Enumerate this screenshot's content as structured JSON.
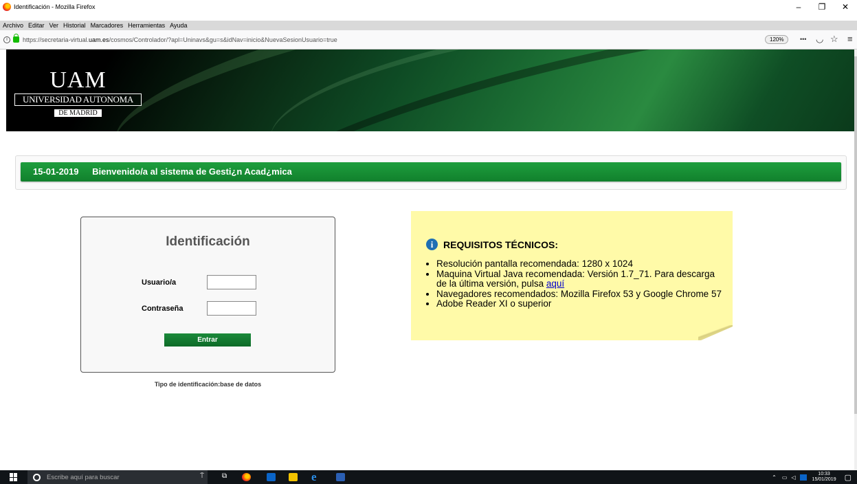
{
  "window": {
    "title": "Identificación - Mozilla Firefox",
    "minimize": "–",
    "restore": "❐",
    "close": "✕"
  },
  "menubar": {
    "items": [
      "Archivo",
      "Editar",
      "Ver",
      "Historial",
      "Marcadores",
      "Herramientas",
      "Ayuda"
    ]
  },
  "urlbar": {
    "url_prefix": "https://secretaria-virtual.",
    "url_domain": "uam.es",
    "url_suffix": "/cosmos/Controlador/?apl=Uninavs&gu=s&idNav=inicio&NuevaSesionUsuario=true",
    "zoom": "120%",
    "menu_dots": "•••",
    "pocket": "☰",
    "star": "☆",
    "overflow": "≡"
  },
  "logo": {
    "uam": "UAM",
    "university": "UNIVERSIDAD AUTONOMA",
    "city": "DE MADRID"
  },
  "welcome": {
    "date": "15-01-2019",
    "message": "Bienvenido/a al sistema de Gesti¿n Acad¿mica"
  },
  "login": {
    "heading": "Identificación",
    "user_label": "Usuario/a",
    "password_label": "Contraseña",
    "user_value": "",
    "password_value": "",
    "submit_label": "Entrar",
    "id_type": "Tipo de identificación:base de datos"
  },
  "requirements": {
    "title": "REQUISITOS TÉCNICOS:",
    "item1": "Resolución pantalla recomendada: 1280 x 1024",
    "item2_text": "Maquina Virtual Java recomendada: Versión 1.7_71. Para descarga de la última versión, pulsa ",
    "item2_link": "aquí",
    "item3": "Navegadores recomendados: Mozilla Firefox 53 y Google Chrome 57",
    "item4": "Adobe Reader XI o superior"
  },
  "taskbar": {
    "search_placeholder": "Escribe aquí para buscar",
    "time": "10:33",
    "date": "15/01/2019"
  },
  "colors": {
    "accent_green": "#11802c",
    "note_yellow": "#fffaa8",
    "link_blue": "#0000cc"
  }
}
